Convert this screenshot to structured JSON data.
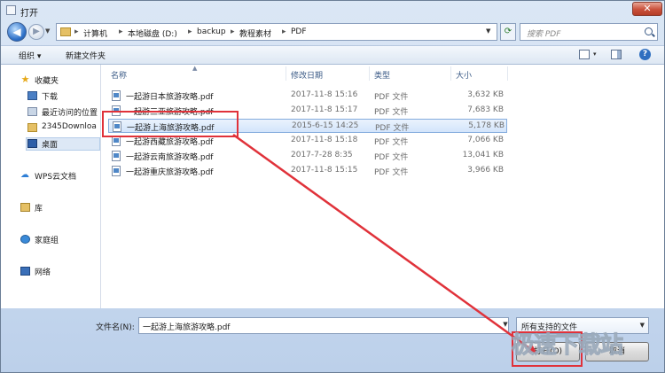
{
  "window": {
    "title": "打开",
    "close_glyph": "✕"
  },
  "nav": {
    "back_glyph": "◀",
    "forward_glyph": "▶",
    "breadcrumb": [
      "计算机",
      "本地磁盘 (D:)",
      "backup",
      "教程素材",
      "PDF"
    ],
    "separator": "▸",
    "search_placeholder": "搜索 PDF"
  },
  "toolbar": {
    "organize": "组织 ▾",
    "new_folder": "新建文件夹",
    "view_drop": "▾",
    "help": "?"
  },
  "sidebar": {
    "items": [
      {
        "label": "收藏夹",
        "icon": "star-icon"
      },
      {
        "label": "下载",
        "icon": "download-folder-icon"
      },
      {
        "label": "最近访问的位置",
        "icon": "recent-places-icon"
      },
      {
        "label": "2345Downloa",
        "icon": "folder-icon"
      },
      {
        "label": "桌面",
        "icon": "desktop-icon"
      },
      {
        "label": "WPS云文档",
        "icon": "cloud-icon"
      },
      {
        "label": "库",
        "icon": "library-icon"
      },
      {
        "label": "家庭组",
        "icon": "homegroup-icon"
      },
      {
        "label": "网络",
        "icon": "network-icon"
      }
    ]
  },
  "columns": {
    "name": "名称",
    "date": "修改日期",
    "type": "类型",
    "size": "大小"
  },
  "files": [
    {
      "name": "一起游日本旅游攻略.pdf",
      "date": "2017-11-8 15:16",
      "type": "PDF 文件",
      "size": "3,632 KB",
      "selected": false
    },
    {
      "name": "一起游三亚旅游攻略.pdf",
      "date": "2017-11-8 15:17",
      "type": "PDF 文件",
      "size": "7,683 KB",
      "selected": false
    },
    {
      "name": "一起游上海旅游攻略.pdf",
      "date": "2015-6-15 14:25",
      "type": "PDF 文件",
      "size": "5,178 KB",
      "selected": true
    },
    {
      "name": "一起游西藏旅游攻略.pdf",
      "date": "2017-11-8 15:18",
      "type": "PDF 文件",
      "size": "7,066 KB",
      "selected": false
    },
    {
      "name": "一起游云南旅游攻略.pdf",
      "date": "2017-7-28 8:35",
      "type": "PDF 文件",
      "size": "13,041 KB",
      "selected": false
    },
    {
      "name": "一起游重庆旅游攻略.pdf",
      "date": "2017-11-8 15:15",
      "type": "PDF 文件",
      "size": "3,966 KB",
      "selected": false
    }
  ],
  "footer": {
    "filename_label": "文件名(N):",
    "filename_value": "一起游上海旅游攻略.pdf",
    "filter_value": "所有支持的文件",
    "open_button": "打开(O)",
    "cancel_button": "取消"
  },
  "watermark": "极速下载站",
  "colors": {
    "highlight": "#e0323a",
    "selection": "#d3e5fb",
    "chrome": "#c9daf0"
  }
}
